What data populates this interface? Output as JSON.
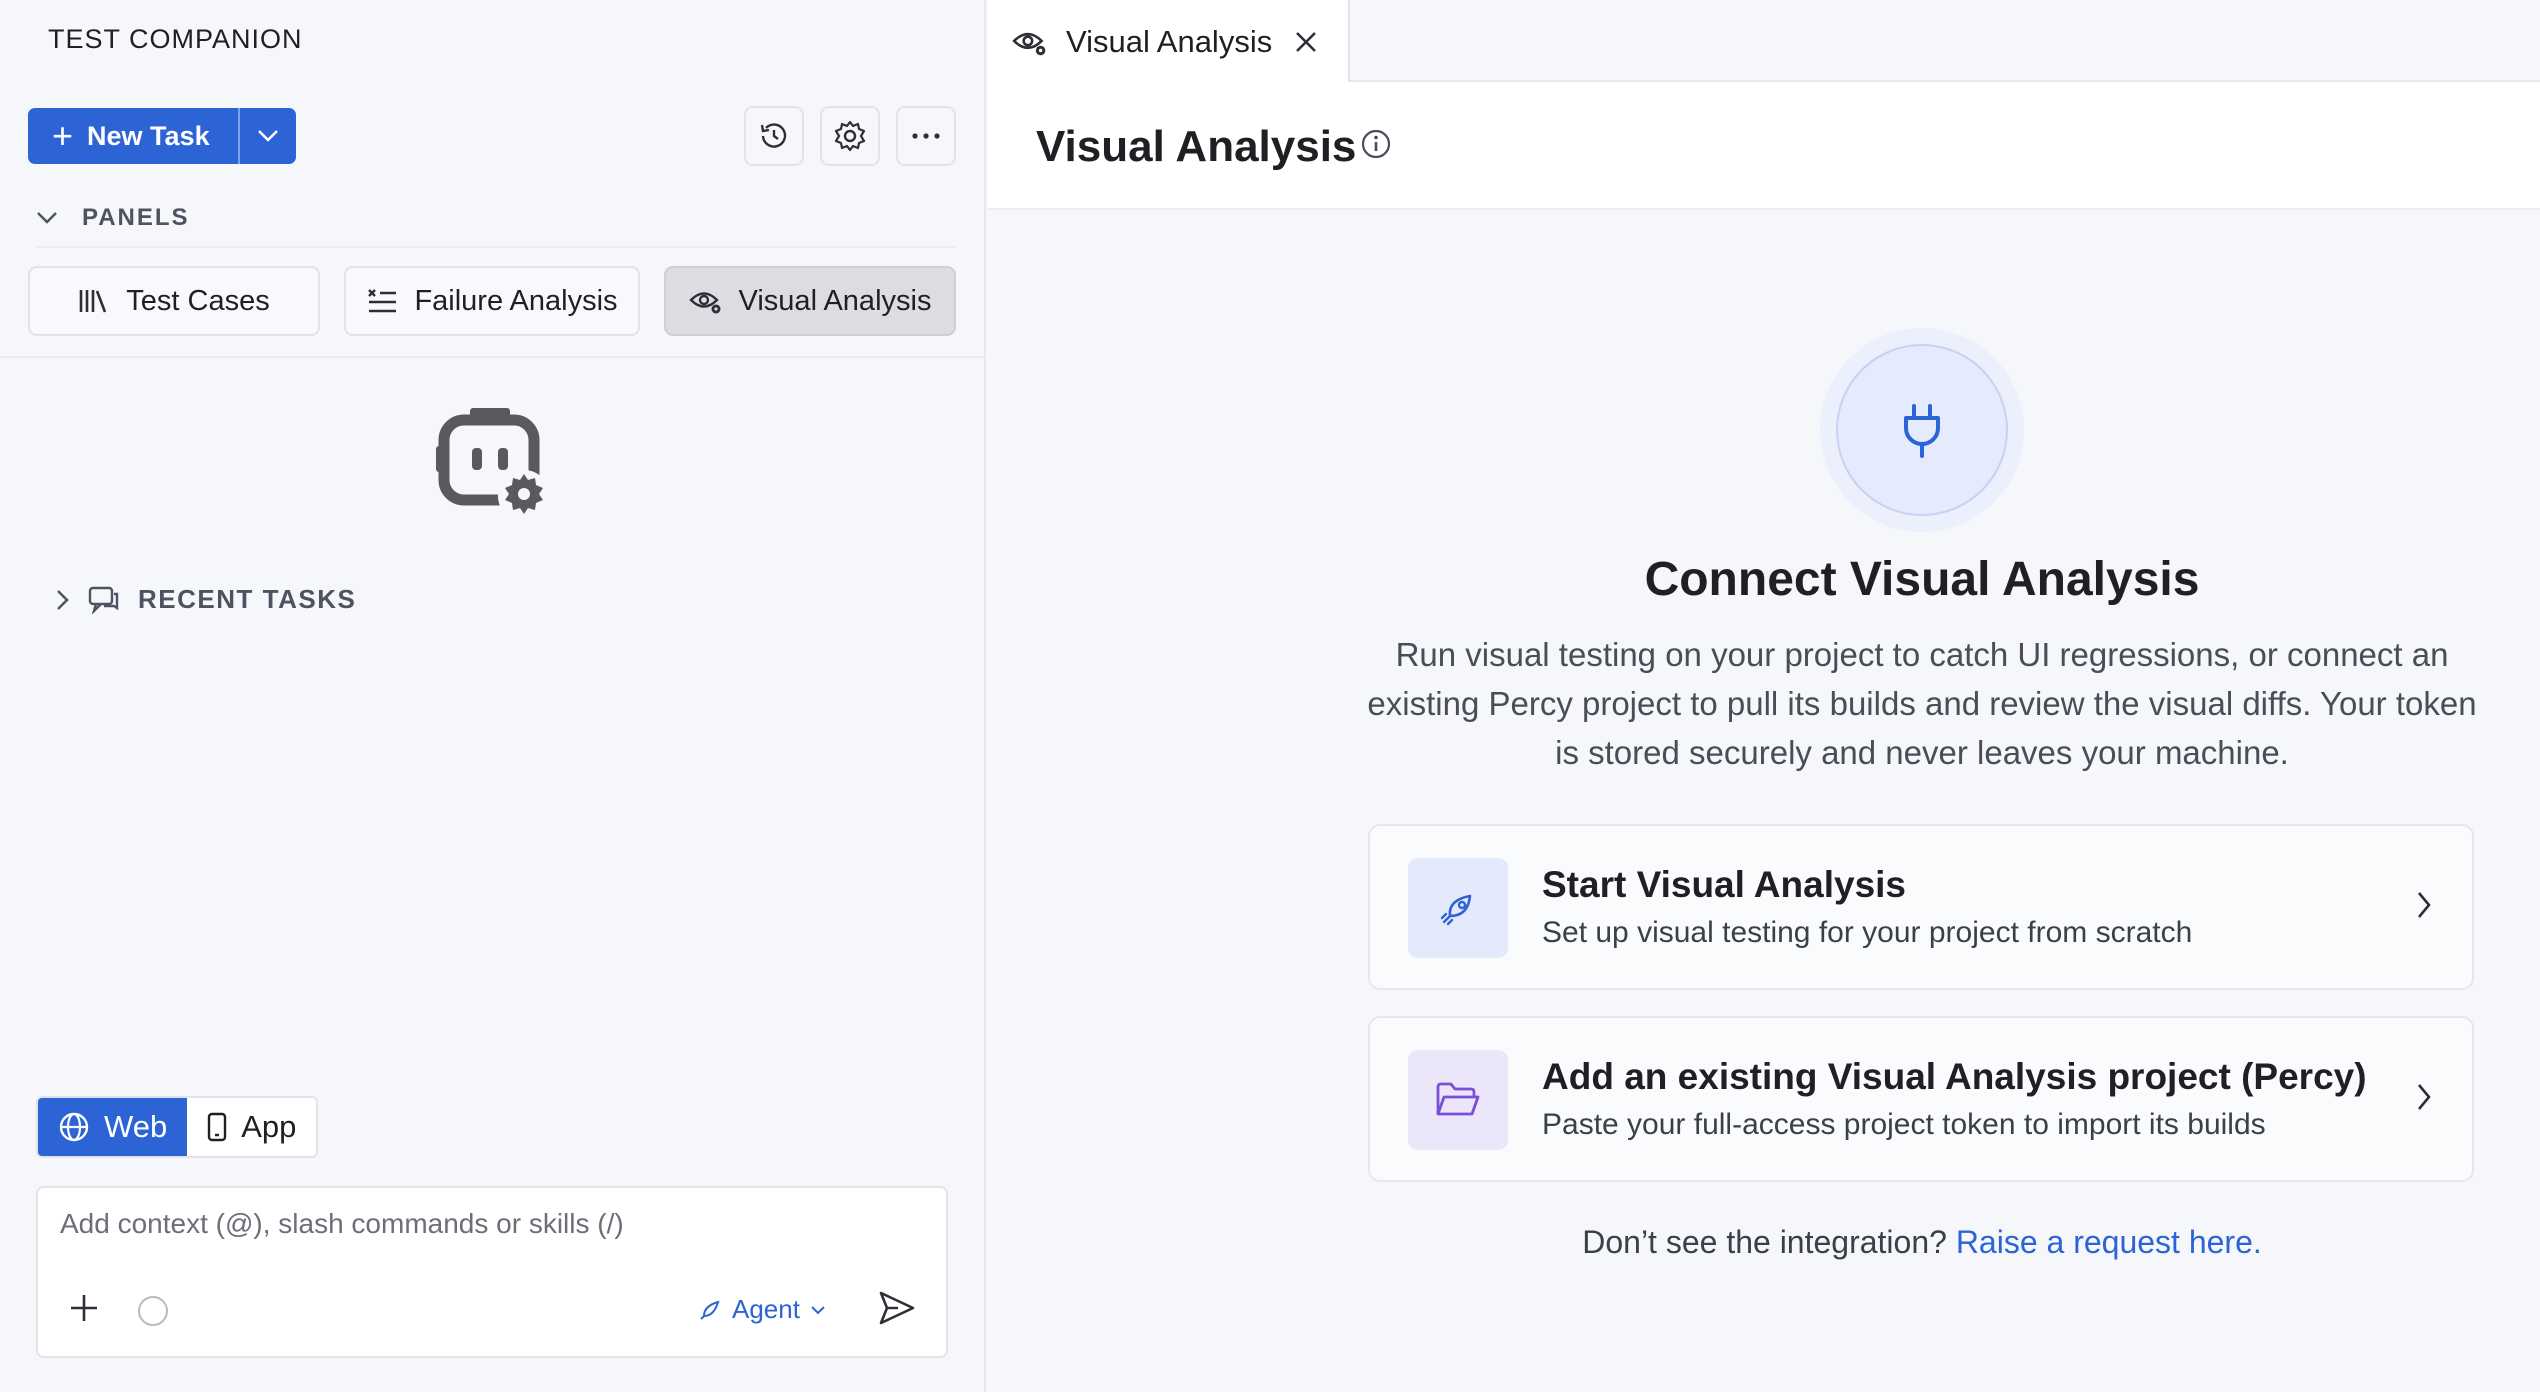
{
  "app": {
    "title": "TEST COMPANION"
  },
  "toolbar": {
    "new_task_label": "New Task",
    "icons": [
      "history-icon",
      "settings-icon",
      "more-icon"
    ]
  },
  "panels": {
    "heading": "PANELS",
    "buttons": [
      {
        "label": "Test Cases",
        "icon": "library-icon"
      },
      {
        "label": "Failure Analysis",
        "icon": "list-x-icon"
      },
      {
        "label": "Visual Analysis",
        "icon": "eye-gear-icon",
        "active": true
      }
    ]
  },
  "recent": {
    "heading": "RECENT TASKS"
  },
  "mode": {
    "options": [
      {
        "label": "Web",
        "icon": "globe-icon",
        "selected": true
      },
      {
        "label": "App",
        "icon": "phone-icon",
        "selected": false
      }
    ]
  },
  "composer": {
    "placeholder": "Add context (@), slash commands or skills (/)",
    "agent_label": "Agent"
  },
  "tab": {
    "label": "Visual Analysis"
  },
  "page": {
    "title": "Visual Analysis",
    "connect_title": "Connect Visual Analysis",
    "connect_description": "Run visual testing on your project to catch UI regressions, or connect an existing Percy project to pull its builds and review the visual diffs. Your token is stored securely and never leaves your machine.",
    "cards": [
      {
        "title": "Start Visual Analysis",
        "subtitle": "Set up visual testing for your project from scratch",
        "icon": "rocket-icon"
      },
      {
        "title": "Add an existing Visual Analysis project (Percy)",
        "subtitle": "Paste your full-access project token to import its builds",
        "icon": "folder-icon"
      }
    ],
    "footer_text": "Don’t see the integration?",
    "footer_link": "Raise a request here."
  },
  "colors": {
    "accent": "#2c64d6",
    "card_icon_blue": "#e4e9fb",
    "card_icon_purple": "#ece6fb"
  }
}
